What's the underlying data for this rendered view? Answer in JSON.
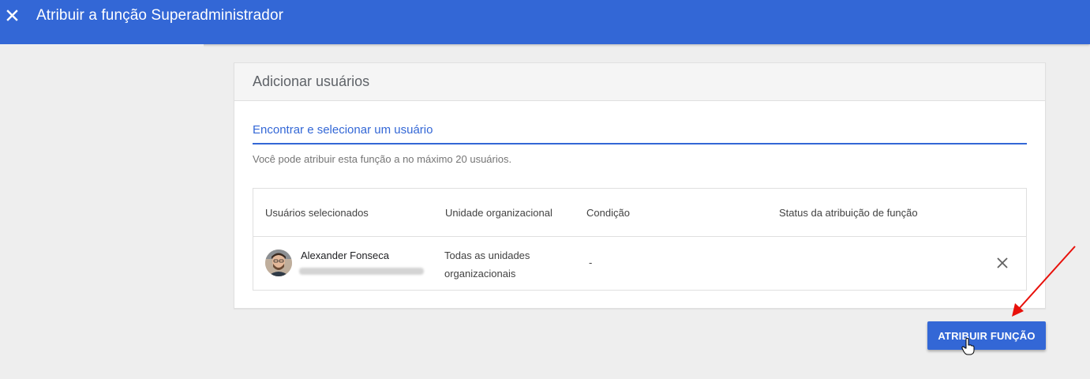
{
  "header": {
    "title": "Atribuir a função Superadministrador",
    "close_icon": "close-icon",
    "background_color": "#3367d6"
  },
  "card": {
    "title": "Adicionar usuários",
    "search": {
      "placeholder": "Encontrar e selecionar um usuário",
      "value": ""
    },
    "hint": "Você pode atribuir esta função a no máximo 20 usuários.",
    "table": {
      "columns": [
        "Usuários selecionados",
        "Unidade organizacional",
        "Condição",
        "Status da atribuição de função"
      ],
      "rows": [
        {
          "name": "Alexander Fonseca",
          "email": "",
          "email_redacted": true,
          "org_unit": "Todas as unidades organizacionais",
          "condition": "-",
          "status": "",
          "remove_icon": "close-icon"
        }
      ]
    }
  },
  "actions": {
    "assign_label": "ATRIBUIR FUNÇÃO",
    "accent_color": "#3367d6"
  },
  "annotation": {
    "arrow_color": "#e8100a",
    "cursor_icon": "hand-pointer-icon"
  }
}
